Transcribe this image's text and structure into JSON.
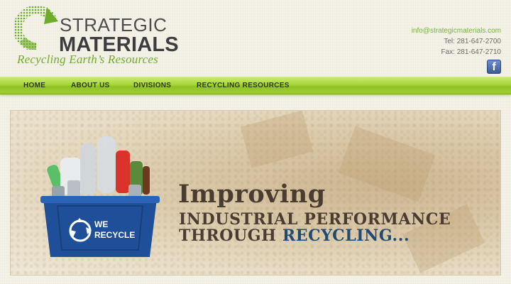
{
  "header": {
    "brand_line1": "STRATEGIC",
    "brand_line2": "MATERIALS",
    "tagline": "Recycling Earth’s Resources",
    "logo_icon": "recycle-arrow-icon"
  },
  "contact": {
    "email": "info@strategicmaterials.com",
    "tel": "Tel: 281-647-2700",
    "fax": "Fax: 281-647-2710",
    "facebook_glyph": "f"
  },
  "nav": {
    "items": [
      {
        "label": "HOME"
      },
      {
        "label": "ABOUT US"
      },
      {
        "label": "DIVISIONS"
      },
      {
        "label": "RECYCLING RESOURCES"
      }
    ]
  },
  "banner": {
    "headline1": "Improving",
    "headline2": "INDUSTRIAL PERFORMANCE",
    "headline3_prefix": "THROUGH ",
    "headline3_accent": "RECYCLING...",
    "bin_label_line1": "WE",
    "bin_label_line2": "RECYCLE"
  },
  "colors": {
    "brand_green": "#7ab33a",
    "nav_green": "#a6d63a",
    "text_dark": "#4a3c31",
    "accent_blue": "#1e4a73",
    "bin_blue": "#1f4f98"
  }
}
